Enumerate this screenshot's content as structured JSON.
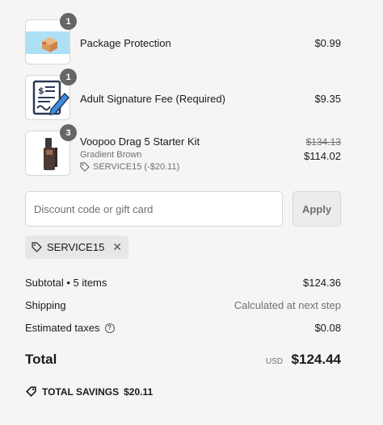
{
  "items": [
    {
      "name": "Package Protection",
      "quantity": "1",
      "price": "$0.99",
      "icon": "package-protection-icon"
    },
    {
      "name": "Adult Signature Fee (Required)",
      "quantity": "1",
      "price": "$9.35",
      "icon": "signature-document-icon"
    },
    {
      "name": "Voopoo Drag 5 Starter Kit",
      "quantity": "3",
      "variant": "Gradient Brown",
      "discount": "SERVICE15 (-$20.11)",
      "original_price": "$134.13",
      "price": "$114.02",
      "icon": "vape-kit-image"
    }
  ],
  "discount": {
    "placeholder": "Discount code or gift card",
    "value": "",
    "apply_label": "Apply"
  },
  "applied_code": "SERVICE15",
  "summary": {
    "subtotal_label": "Subtotal • 5 items",
    "subtotal_value": "$124.36",
    "shipping_label": "Shipping",
    "shipping_value": "Calculated at next step",
    "taxes_label": "Estimated taxes",
    "taxes_value": "$0.08"
  },
  "total": {
    "label": "Total",
    "currency": "USD",
    "amount": "$124.44"
  },
  "savings": {
    "label": "TOTAL SAVINGS",
    "amount": "$20.11"
  },
  "colors": {
    "background": "#f5f5f5",
    "badge": "#666666",
    "muted_text": "#707070"
  }
}
